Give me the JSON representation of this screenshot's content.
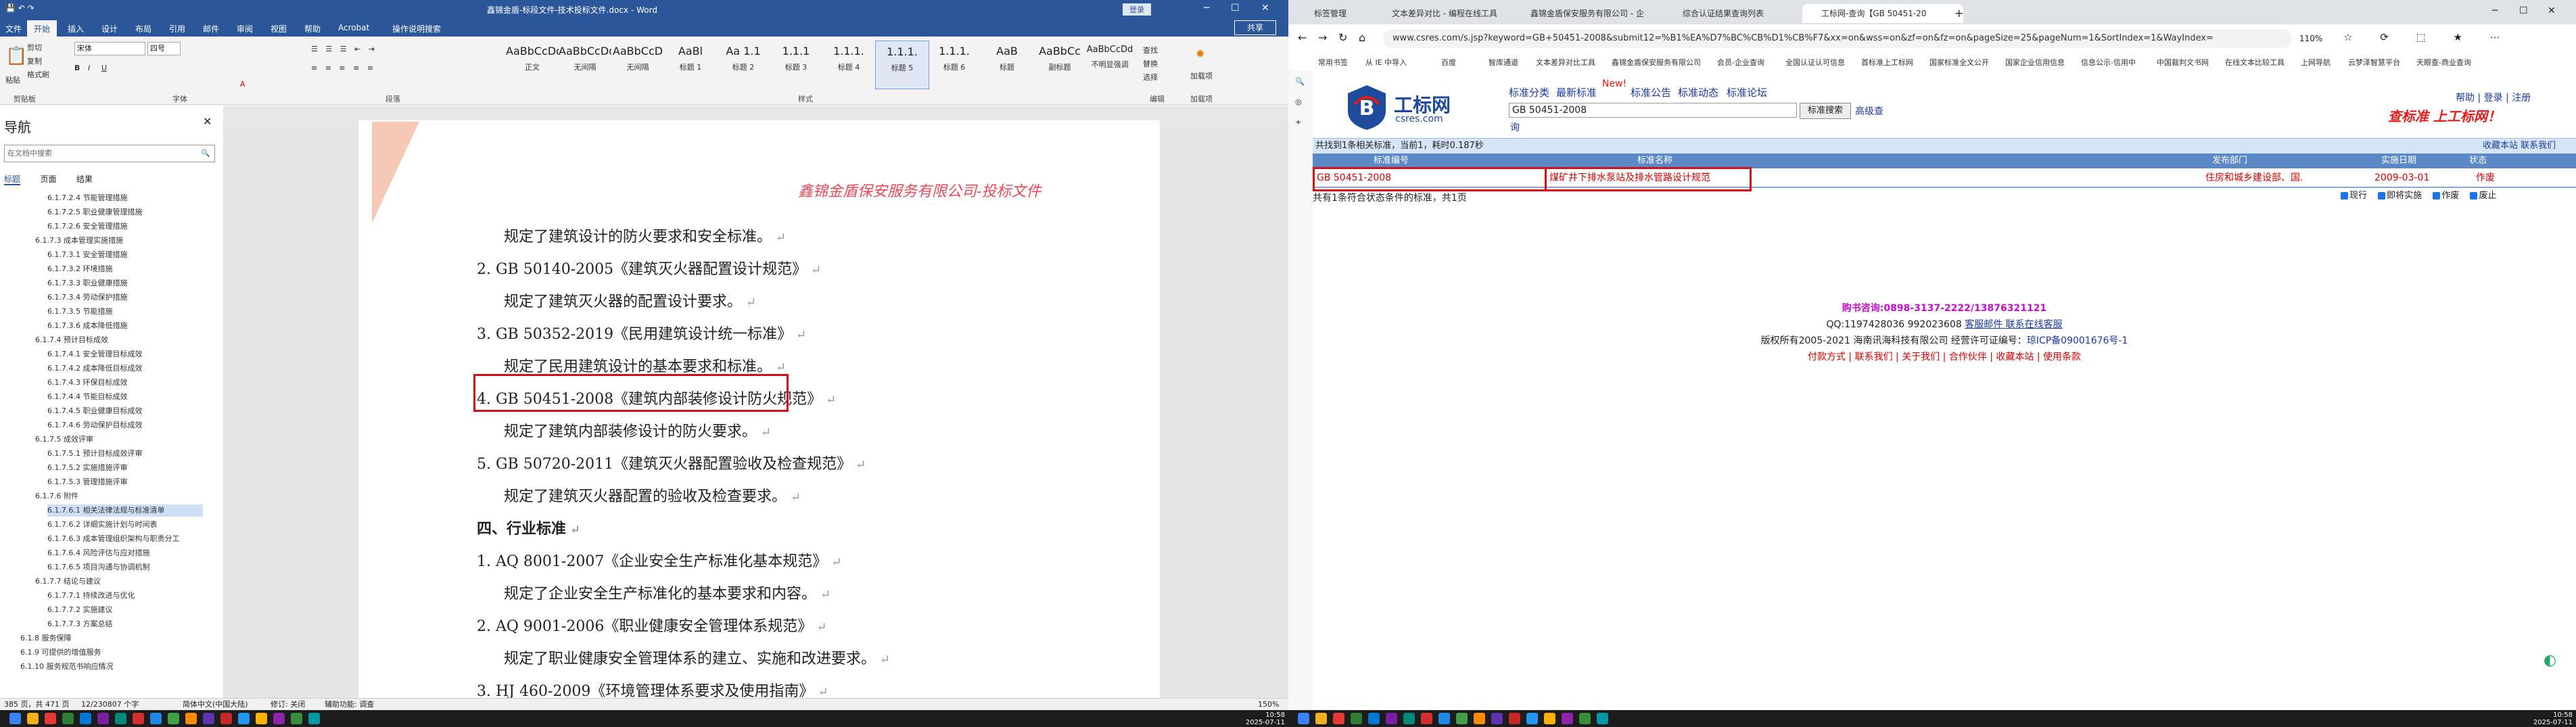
{
  "word": {
    "title": "鑫锦金盾-标段文件-技术投标文件.docx - Word",
    "user_badge": "登录",
    "share_label": "共享",
    "file_tab": "文件",
    "tabs": [
      "开始",
      "插入",
      "设计",
      "布局",
      "引用",
      "邮件",
      "审阅",
      "视图",
      "帮助",
      "Acrobat",
      "操作说明搜索"
    ],
    "ribbon": {
      "clipboard": {
        "paste": "粘贴",
        "cut": "剪切",
        "copy": "复制",
        "format_painter": "格式刷",
        "label": "剪贴板"
      },
      "font": {
        "name": "宋体",
        "size": "四号",
        "label": "字体"
      },
      "paragraph_label": "段落",
      "styles_label": "样式",
      "styles": [
        {
          "preview": "AaBbCcDd",
          "name": "正文"
        },
        {
          "preview": "AaBbCcDd",
          "name": "无间隔"
        },
        {
          "preview": "AaBbCcD",
          "name": "无间隔"
        },
        {
          "preview": "AaBl",
          "name": "标题 1"
        },
        {
          "preview": "Aa 1.1",
          "name": "标题 2"
        },
        {
          "preview": "1.1.1",
          "name": "标题 3"
        },
        {
          "preview": "1.1.1.",
          "name": "标题 4"
        },
        {
          "preview": "1.1.1.",
          "name": "标题 5"
        },
        {
          "preview": "1.1.1.",
          "name": "标题 6"
        },
        {
          "preview": "AaB",
          "name": "标题"
        },
        {
          "preview": "AaBbCc",
          "name": "副标题"
        },
        {
          "preview": "AaBbCcDd",
          "name": "不明显强调"
        }
      ],
      "editing": {
        "find": "查找",
        "replace": "替换",
        "select": "选择",
        "label": "编辑"
      },
      "addin": {
        "label": "加载项",
        "name": "加载项"
      }
    },
    "nav": {
      "title": "导航",
      "search_placeholder": "在文档中搜索",
      "tabs": [
        "标题",
        "页面",
        "结果"
      ],
      "items": [
        "6.1.7.2.4 节能管理措施",
        "6.1.7.2.5 职业健康管理措施",
        "6.1.7.2.6 安全管理措施",
        "6.1.7.3 成本管理实施措施",
        "6.1.7.3.1 安全管理措施",
        "6.1.7.3.2 环境措施",
        "6.1.7.3.3 职业健康措施",
        "6.1.7.3.4 劳动保护措施",
        "6.1.7.3.5 节能措施",
        "6.1.7.3.6 成本降低措施",
        "6.1.7.4 预计目标成效",
        "6.1.7.4.1 安全管理目标成效",
        "6.1.7.4.2 成本降低目标成效",
        "6.1.7.4.3 环保目标成效",
        "6.1.7.4.4 节能目标成效",
        "6.1.7.4.5 职业健康目标成效",
        "6.1.7.4.6 劳动保护目标成效",
        "6.1.7.5 成效评审",
        "6.1.7.5.1 预计目标成效评审",
        "6.1.7.5.2 实施措施评审",
        "6.1.7.5.3 管理措施评审",
        "6.1.7.6 附件",
        "6.1.7.6.1 相关法律法规与标准清单",
        "6.1.7.6.2 详细实施计划与时间表",
        "6.1.7.6.3 成本管理组织架构与职责分工",
        "6.1.7.6.4 风险评估与应对措施",
        "6.1.7.6.5 项目沟通与协调机制",
        "6.1.7.7 结论与建议",
        "6.1.7.7.1 持续改进与优化",
        "6.1.7.7.2 实施建议",
        "6.1.7.7.3 方案总结",
        "6.1.8 服务保障",
        "6.1.9 可提供的增值服务",
        "6.1.10 服务规范书响应情况"
      ]
    },
    "doc": {
      "header": "鑫锦金盾保安服务有限公司-投标文件",
      "lines": [
        "规定了建筑设计的防火要求和安全标准。",
        "2. GB 50140-2005《建筑灭火器配置设计规范》",
        "规定了建筑灭火器的配置设计要求。",
        "3. GB 50352-2019《民用建筑设计统一标准》",
        "规定了民用建筑设计的基本要求和标准。",
        "4. GB 50451-2008《建筑内部装修设计防火规范》",
        "规定了建筑内部装修设计的防火要求。",
        "5. GB 50720-2011《建筑灭火器配置验收及检查规范》",
        "规定了建筑灭火器配置的验收及检查要求。",
        "四、行业标准",
        "1. AQ 8001-2007《企业安全生产标准化基本规范》",
        "规定了企业安全生产标准化的基本要求和内容。",
        "2. AQ 9001-2006《职业健康安全管理体系规范》",
        "规定了职业健康安全管理体系的建立、实施和改进要求。",
        "3. HJ 460-2009《环境管理体系要求及使用指南》"
      ]
    },
    "status": {
      "page": "385 页，共 471 页",
      "words": "12/230807 个字",
      "lang": "简体中文(中国大陆)",
      "revision": "修订: 关闭",
      "accessibility": "辅助功能: 调查",
      "zoom": "150%"
    }
  },
  "browser": {
    "tabs": [
      "标签管理",
      "文本差异对比 - 编程在线工具",
      "鑫锦金盾保安服务有限公司 - 企",
      "综合认证结果查询列表",
      "工标网-查询【GB 50451-20"
    ],
    "url": "www.csres.com/s.jsp?keyword=GB+50451-2008&submit12=%B1%EA%D7%BC%CB%D1%CB%F7&xx=on&wss=on&zf=on&fz=on&pageSize=25&pageNum=1&SortIndex=1&WayIndex=",
    "zoom": "110%",
    "bookmarks": [
      "常用书签",
      "从 IE 中导入",
      "百度",
      "智库通道",
      "文本差异对比工具",
      "鑫锦金盾保安服务有限公司",
      "会员-企业查询",
      "全国认证认可信息",
      "首标准上工标网",
      "国家标准全文公开",
      "国家企业信用信息",
      "信息公示-信用中",
      "中国裁判文书网",
      "在线文本比较工具",
      "上网导航",
      "云梦泽智慧平台",
      "天眼查-商业查询"
    ],
    "site": {
      "logo_name": "工标网",
      "logo_domain": "csres.com",
      "nav": [
        "标准分类",
        "最新标准",
        "标准公告",
        "标准动态",
        "标准论坛"
      ],
      "new_tag": "New!",
      "search_value": "GB 50451-2008",
      "search_btn": "标准搜索",
      "advanced": "高级查",
      "advanced2": "询",
      "toplinks": "帮助 | 登录 | 注册",
      "slogan": "查标准 上工标网！",
      "result_summary": "共找到1条相关标准，当前1，耗时0.187秒",
      "result_right": "收藏本站  联系我们",
      "headers": [
        "标准编号",
        "标准名称",
        "发布部门",
        "实施日期",
        "状态"
      ],
      "row": {
        "code": "GB 50451-2008",
        "name": "煤矿井下排水泵站及排水管路设计规范",
        "dept": "住房和城乡建设部、国.",
        "date": "2009-03-01",
        "status": "作废"
      },
      "row_info": "共有1条符合状态条件的标准，共1页",
      "checks": [
        "现行",
        "即将实施",
        "作废",
        "废止"
      ],
      "footer": {
        "phone": "购书咨询:0898-3137-2222/13876321121",
        "qq": "QQ:1197428036 992023608",
        "qq_link": "客服邮件 联系在线客服",
        "copyright": "版权所有2005-2021 海南讯海科技有限公司 经营许可证编号：",
        "icp": "琼ICP备09001676号-1",
        "links": "付款方式 | 联系我们 | 关于我们 | 合作伙伴 | 收藏本站 | 使用条款"
      }
    }
  },
  "taskbar": {
    "left_time": "10:58",
    "left_date": "2025-07-11",
    "right_time": "10:58",
    "right_date": "2025-07-11"
  },
  "colors": {
    "word_blue": "#2b579a",
    "highlight_red": "#d0111b",
    "site_red": "#e41b1b",
    "site_blue": "#1b3aa0"
  }
}
